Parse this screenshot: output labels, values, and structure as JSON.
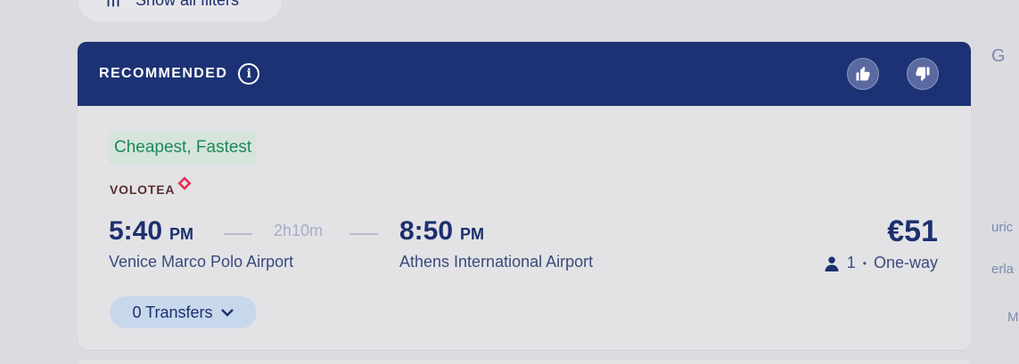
{
  "filters": {
    "label": "Show all filters"
  },
  "card": {
    "header_label": "RECOMMENDED",
    "info_icon": "info-icon",
    "thumb_up_icon": "thumb-up-icon",
    "thumb_down_icon": "thumb-down-icon",
    "tag": "Cheapest, Fastest",
    "airline": "VOLOTEA",
    "departure": {
      "time": "5:40",
      "ampm": "PM",
      "airport": "Venice Marco Polo Airport"
    },
    "duration": "2h10m",
    "arrival": {
      "time": "8:50",
      "ampm": "PM",
      "airport": "Athens International Airport"
    },
    "price": "€51",
    "passengers": "1",
    "separator": "•",
    "trip_type": "One-way",
    "transfers": "0 Transfers"
  },
  "side_map": {
    "fragment1": "G",
    "fragment2": "uric",
    "fragment3": "erla",
    "fragment4": "M"
  },
  "colors": {
    "header_bg": "#1c3274",
    "tag_bg": "#d6e4dc",
    "tag_text": "#1a8a58",
    "transfers_bg": "#c8d8ec",
    "primary_text": "#1c2f6e"
  }
}
